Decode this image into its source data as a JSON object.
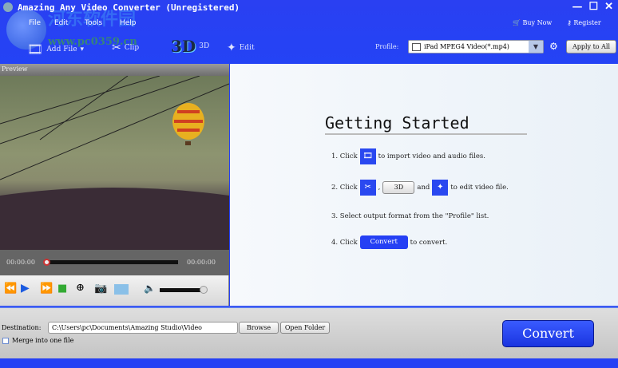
{
  "window": {
    "title": "Amazing Any Video Converter (Unregistered)",
    "controls": [
      "—",
      "☐",
      "✕"
    ]
  },
  "watermark": {
    "text": "河东软件园",
    "url": "www.pc0359.cn"
  },
  "menu": [
    "File",
    "Edit",
    "Tools",
    "Help"
  ],
  "toolbar": {
    "add_file": "Add File",
    "clip": "Clip",
    "three_d": "3D",
    "edit": "Edit"
  },
  "links": {
    "buy": "Buy Now",
    "register": "Register"
  },
  "profile": {
    "label": "Profile:",
    "value": "iPad MPEG4 Video(*.mp4)",
    "apply": "Apply to All"
  },
  "preview": {
    "label": "Preview",
    "time_start": "00:00:00",
    "time_end": "00:00:00",
    "volume": 0.95,
    "progress": 0
  },
  "getting_started": {
    "title": "Getting Started",
    "s1a": "1. Click",
    "s1b": "to import video and audio files.",
    "s2a": "2. Click",
    "s2comma": ",",
    "s2btn": "3D",
    "s2and": "and",
    "s2b": "to edit video file.",
    "s3": "3. Select output format from the \"Profile\" list.",
    "s4a": "4. Click",
    "s4btn": "Convert",
    "s4b": "to convert."
  },
  "bottom": {
    "dest_label": "Destination:",
    "dest_value": "C:\\Users\\pc\\Documents\\Amazing Studio\\Video",
    "browse": "Browse",
    "open_folder": "Open Folder",
    "merge": "Merge into one file",
    "merge_checked": false,
    "convert": "Convert"
  }
}
